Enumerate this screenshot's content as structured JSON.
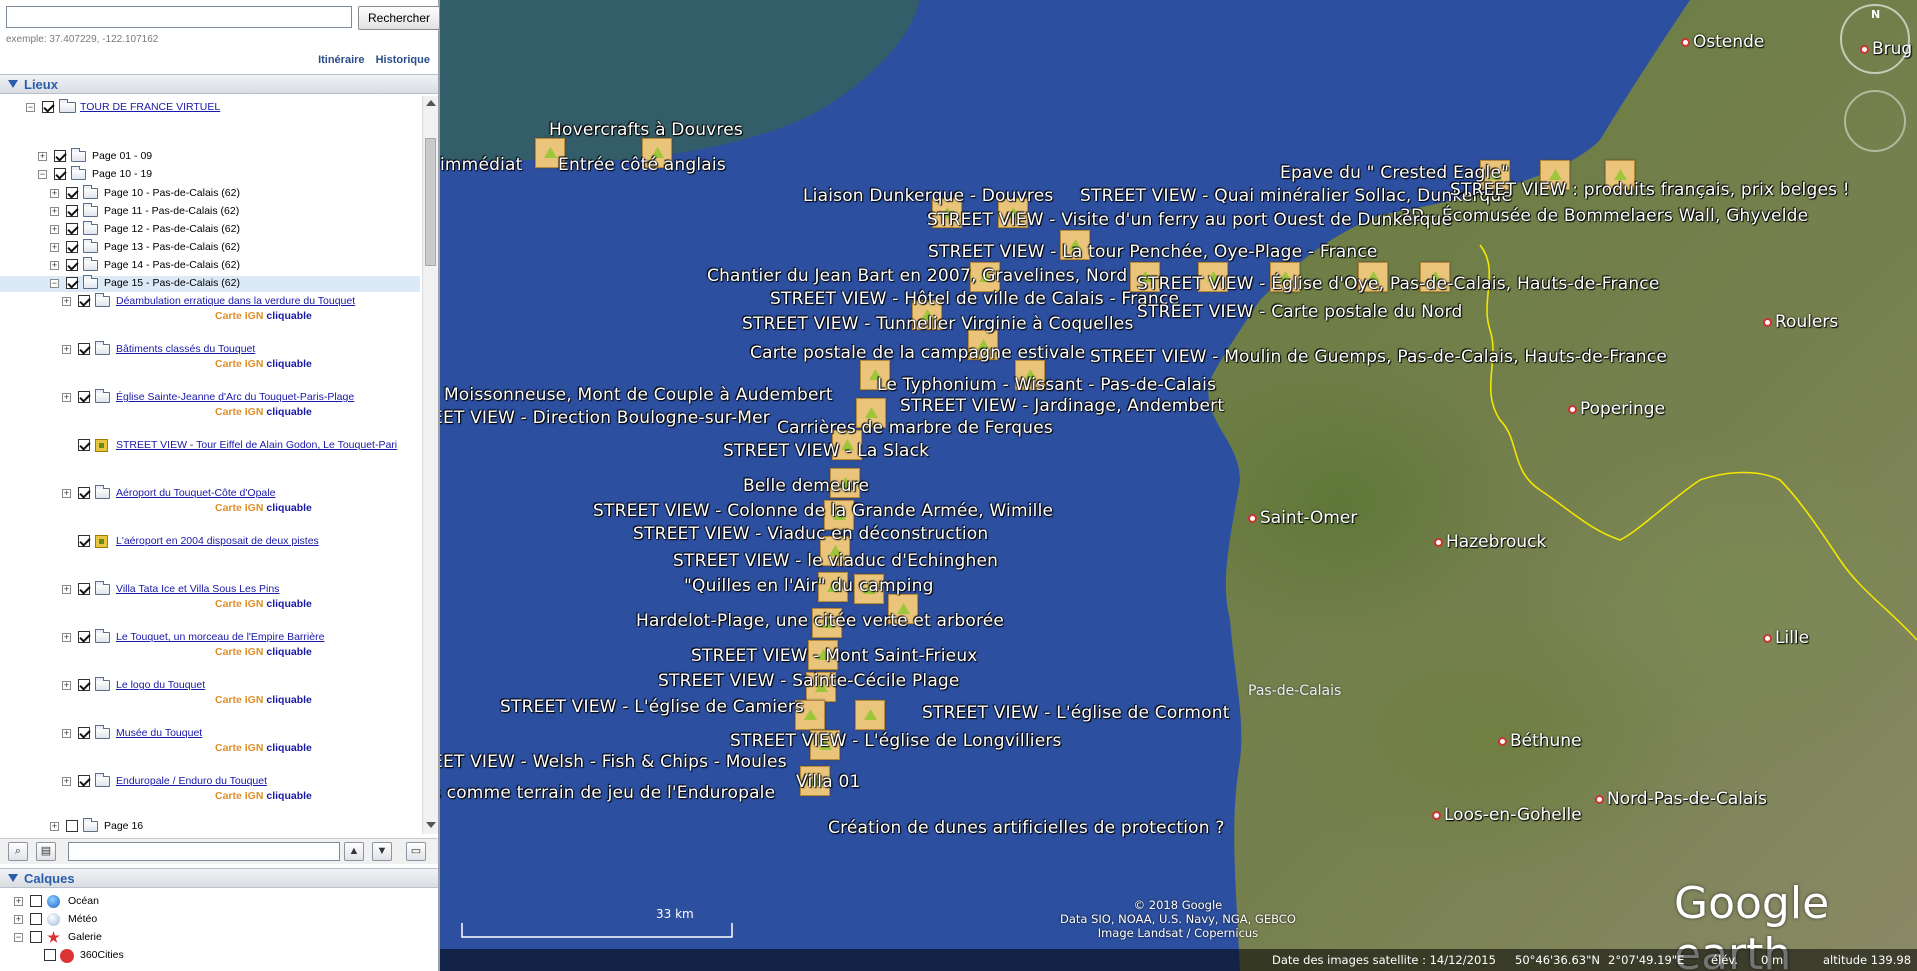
{
  "search": {
    "placeholder": "",
    "value": "",
    "button": "Rechercher",
    "hint": "exemple: 37.407229, -122.107162"
  },
  "nav": {
    "itineraire": "Itinéraire",
    "historique": "Historique"
  },
  "lieux": {
    "title": "Lieux",
    "root": "TOUR DE FRANCE VIRTUEL",
    "pages": [
      {
        "label": "Page 01 - 09"
      },
      {
        "label": "Page 10 - 19"
      }
    ],
    "subpages": [
      {
        "label": "Page 10 - Pas-de-Calais (62)"
      },
      {
        "label": "Page 11 - Pas-de-Calais (62)"
      },
      {
        "label": "Page 12 - Pas-de-Calais (62)"
      },
      {
        "label": "Page 13 - Pas-de-Calais (62)"
      },
      {
        "label": "Page 14 - Pas-de-Calais (62)"
      },
      {
        "label": "Page 15 - Pas-de-Calais (62)"
      }
    ],
    "items": [
      {
        "label": "Déambulation erratique dans la verdure du Touquet",
        "ign": true,
        "kind": "folder"
      },
      {
        "label": "Bâtiments classés du Touquet",
        "ign": true,
        "kind": "folder"
      },
      {
        "label": "Église Sainte-Jeanne d'Arc du Touquet-Paris-Plage",
        "ign": true,
        "kind": "folder"
      },
      {
        "label": "STREET VIEW - Tour Eiffel de Alain Godon, Le Touquet-Pari",
        "ign": false,
        "kind": "pin"
      },
      {
        "label": "Aéroport du Touquet-Côte d'Opale",
        "ign": true,
        "kind": "folder"
      },
      {
        "label": "L'aéroport en 2004 disposait de deux pistes",
        "ign": false,
        "kind": "pin"
      },
      {
        "label": "Villa Tata Ice et Villa Sous Les Pins",
        "ign": true,
        "kind": "folder"
      },
      {
        "label": "Le Touquet, un morceau de l'Empire Barrière",
        "ign": true,
        "kind": "folder"
      },
      {
        "label": "Le logo du Touquet",
        "ign": true,
        "kind": "folder"
      },
      {
        "label": "Musée du Touquet",
        "ign": true,
        "kind": "folder"
      },
      {
        "label": "Enduropale / Enduro du Touquet",
        "ign": true,
        "kind": "folder"
      }
    ],
    "ign_label": "Carte IGN",
    "clickable_label": "cliquable",
    "page16": "Page 16"
  },
  "calques": {
    "title": "Calques",
    "items": [
      {
        "label": "Océan"
      },
      {
        "label": "Météo"
      },
      {
        "label": "Galerie"
      },
      {
        "label": "360Cities"
      }
    ]
  },
  "map": {
    "placemarks": [
      "Hovercrafts à Douvres",
      "immédiat",
      "Entrée côté anglais",
      "Epave du \" Crested Eagle\"",
      "Liaison Dunkerque - Douvres",
      "STREET VIEW - Quai minéralier Sollac, Dunkerque",
      "STREET VIEW : produits français, prix belges !",
      "3D - Écomusée de Bommelaers Wall, Ghyvelde",
      "STREET VIEW - Visite d'un ferry au port Ouest de Dunkerque",
      "STREET VIEW - La tour Penchée, Oye-Plage - France",
      "Chantier du Jean Bart en 2007, Gravelines, Nord",
      "STREET VIEW - Église d'Oye, Pas-de-Calais, Hauts-de-France",
      "STREET VIEW - Hôtel de ville de Calais - France",
      "STREET VIEW - Tunnelier Virginie à Coquelles",
      "STREET VIEW - Carte postale du Nord",
      "Carte postale de la campagne estivale",
      "STREET VIEW - Moulin de Guemps, Pas-de-Calais, Hauts-de-France",
      "Le Typhonium - Wissant - Pas-de-Calais",
      "- Moissonneuse, Mont de Couple à Audembert",
      "STREET VIEW - Jardinage, Andembert",
      "EET VIEW - Direction Boulogne-sur-Mer",
      "Carrières de marbre de Ferques",
      "STREET VIEW - La Slack",
      "Belle demeure",
      "STREET VIEW - Colonne de la Grande Armée, Wimille",
      "STREET VIEW - Viaduc en déconstruction",
      "STREET VIEW - le viaduc d'Echinghen",
      "\"Quilles en l'Air\" du camping",
      "Hardelot-Plage, une citée verte et arborée",
      "STREET VIEW - Mont Saint-Frieux",
      "STREET VIEW - Sainte-Cécile Plage",
      "STREET VIEW - L'église de Camiers",
      "STREET VIEW - L'église de Cormont",
      "STREET VIEW - L'église de Longvilliers",
      "EET VIEW - Welsh - Fish & Chips - Moules",
      "Villa 01",
      "s comme terrain de jeu de l'Enduropale",
      "Création de dunes artificielles de protection ?"
    ],
    "cities": [
      "Ostende",
      "Brug",
      "Roulers",
      "Poperinge",
      "Saint-Omer",
      "Hazebrouck",
      "Lille",
      "Béthune",
      "Loos-en-Gohelle",
      "Nord-Pas-de-Calais"
    ],
    "region": "Pas-de-Calais",
    "scale": "33  km",
    "copyright": [
      "© 2018 Google",
      "Data SIO, NOAA, U.S. Navy, NGA, GEBCO",
      "Image Landsat / Copernicus"
    ],
    "brand": "Google earth",
    "status": {
      "date": "Date des images satellite : 14/12/2015",
      "lat": "50°46'36.63\"N",
      "lon": "2°07'49.19\"E",
      "elev_label": "élév.",
      "elev": "0 m",
      "alt": "altitude 139.98 km"
    },
    "compass_n": "N",
    "sea_color": "#2c4fa0",
    "border_color": "#f3e600"
  }
}
